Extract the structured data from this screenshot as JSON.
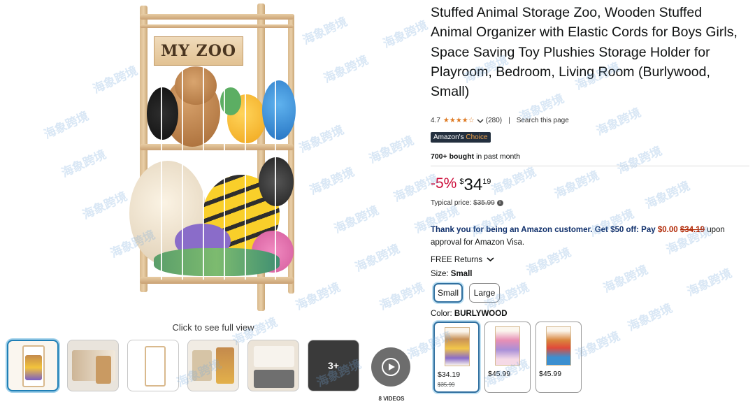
{
  "product": {
    "title": "Stuffed Animal Storage Zoo, Wooden Stuffed Animal Organizer with Elastic Cords for Boys Girls, Space Saving Toy Plushies Storage Holder for Playroom, Bedroom, Living Room (Burlywood, Small)",
    "image_sign": "MY ZOO",
    "click_to_view": "Click to see full view"
  },
  "rating": {
    "score": "4.7",
    "stars": "★★★★☆",
    "count": "(280)",
    "search_page": "Search this page"
  },
  "badge": {
    "prefix": "Amazon's",
    "suffix": "Choice"
  },
  "bought": {
    "count": "700+ bought",
    "rest": "in past month"
  },
  "price": {
    "discount": "-5%",
    "currency": "$",
    "whole": "34",
    "fraction": "19",
    "typical_label": "Typical price:",
    "typical_value": "$35.99",
    "info_icon": "i"
  },
  "visa": {
    "lead": "Thank you for being an Amazon customer. Get $50 off: Pay",
    "new_price": "$0.00",
    "old_price": "$34.19",
    "tail": "upon approval for Amazon Visa."
  },
  "returns": {
    "label": "FREE Returns",
    "chevron": "⌄"
  },
  "size": {
    "label": "Size:",
    "selected": "Small",
    "options": [
      "Small",
      "Large"
    ]
  },
  "color": {
    "label": "Color:",
    "selected": "BURLYWOOD",
    "options": [
      {
        "price": "$34.19",
        "old_price": "$35.99"
      },
      {
        "price": "$45.99"
      },
      {
        "price": "$45.99"
      }
    ]
  },
  "thumbnails": {
    "more_label": "3+",
    "videos_label": "8 VIDEOS"
  },
  "watermark": "海象跨境",
  "colors": {
    "accent_blue": "#2f6f9f",
    "price_red": "#cc0c39",
    "star_orange": "#de7921",
    "badge_bg": "#232f3e"
  }
}
